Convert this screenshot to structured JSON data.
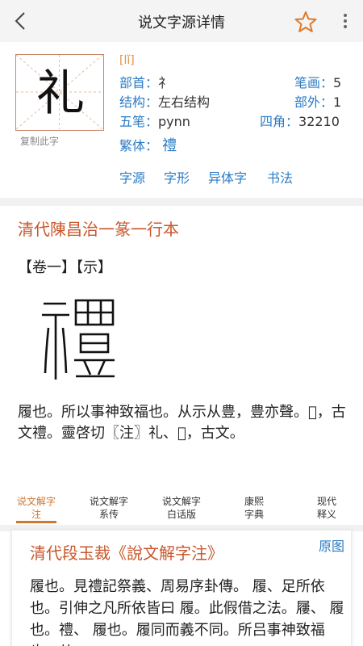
{
  "header": {
    "title": "说文字源详情"
  },
  "char_info": {
    "character": "礼",
    "copy_label": "复制此字",
    "pinyin": "[lǐ]",
    "radical_label": "部首：",
    "radical_value": "礻",
    "strokes_label": "笔画：",
    "strokes_value": "5",
    "structure_label": "结构：",
    "structure_value": "左右结构",
    "outside_label": "部外：",
    "outside_value": "1",
    "wubi_label": "五笔：",
    "wubi_value": "pynn",
    "sijiao_label": "四角：",
    "sijiao_value": "32210",
    "traditional_label": "繁体：",
    "traditional_value": "禮"
  },
  "links": [
    "字源",
    "字形",
    "异体字",
    "书法"
  ],
  "section1": {
    "title": "清代陳昌治一篆一行本",
    "bracket_row": "【卷一】【示】",
    "seal_char": "禮",
    "body": "履也。所以事神致福也。从示从豊，豊亦聲。𥘺，古文禮。靈啓切〖注〗礼、𥛴，古文。"
  },
  "tabs": [
    {
      "line1": "说文解字",
      "line2": "注"
    },
    {
      "line1": "说文解字",
      "line2": "系传"
    },
    {
      "line1": "说文解字",
      "line2": "白话版"
    },
    {
      "line1": "康熙",
      "line2": "字典"
    },
    {
      "line1": "现代",
      "line2": "释义"
    }
  ],
  "section2": {
    "title": "清代段玉裁《說文解字注》",
    "orig_button": "原图",
    "body": "履也。見禮記祭義、周易序卦傳。 履、足所依也。引伸之凡所依皆曰 履。此假借之法。屨、 履也。禮、 履也。履同而義不同。所吕事神致福也。从"
  },
  "colors": {
    "accent_blue": "#2b7bc6",
    "accent_orange": "#c8562a",
    "tab_active": "#d07830"
  }
}
